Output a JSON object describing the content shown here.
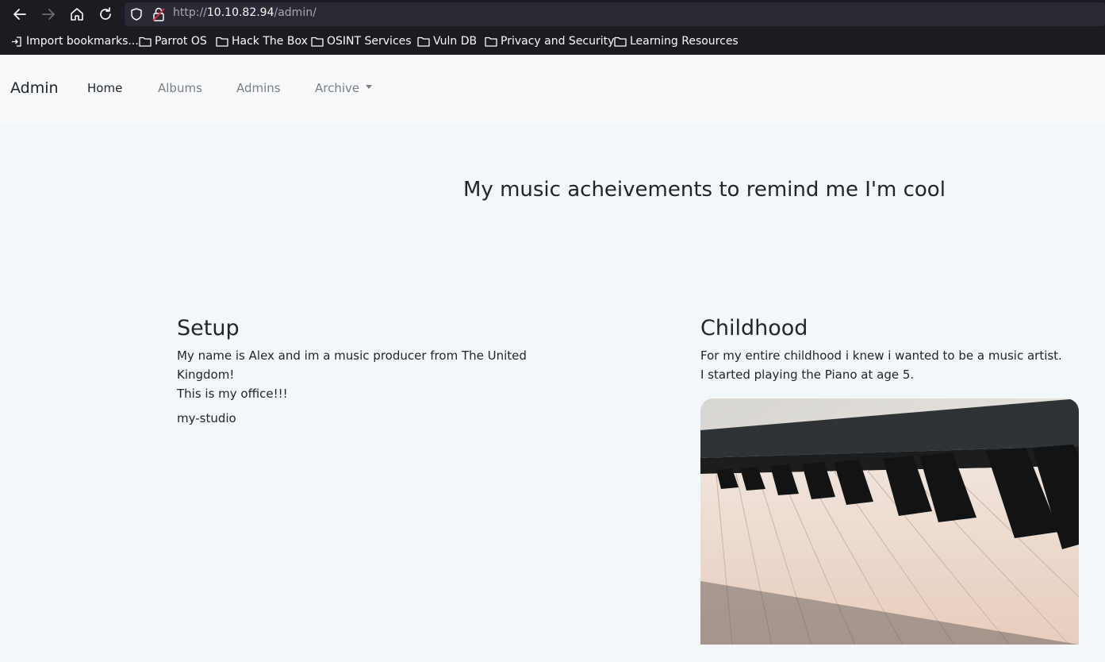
{
  "browser": {
    "url_scheme": "http://",
    "url_host": "10.10.82.94",
    "url_path": "/admin/",
    "bookmarks": [
      {
        "label": "Import bookmarks..."
      },
      {
        "label": "Parrot OS"
      },
      {
        "label": "Hack The Box"
      },
      {
        "label": "OSINT Services"
      },
      {
        "label": "Vuln DB"
      },
      {
        "label": "Privacy and Security"
      },
      {
        "label": "Learning Resources"
      }
    ]
  },
  "navbar": {
    "brand": "Admin",
    "links": [
      {
        "label": "Home",
        "active": true
      },
      {
        "label": "Albums"
      },
      {
        "label": "Admins"
      },
      {
        "label": "Archive"
      }
    ]
  },
  "hero": {
    "title": "My music acheivements to remind me I'm cool"
  },
  "sections": [
    {
      "heading": "Setup",
      "line1": "My name is Alex and im a music producer from The United Kingdom!",
      "line2": "This is my office!!!",
      "image_alt": "my-studio"
    },
    {
      "heading": "Childhood",
      "line1": "For my entire childhood i knew i wanted to be a music artist.",
      "line2": "I started playing the Piano at age 5."
    }
  ],
  "icons": {
    "back": "back-arrow-icon",
    "forward": "forward-arrow-icon",
    "home": "home-icon",
    "reload": "reload-icon",
    "shield": "shield-icon",
    "insecure": "insecure-lock-icon",
    "folder": "folder-icon",
    "import": "import-icon"
  },
  "colors": {
    "chrome_bg": "#1c1b22",
    "page_bg": "#f2f7f9",
    "navbar_bg": "#f8f9fa",
    "text": "#212529",
    "nav_muted": "#7b7f83"
  }
}
